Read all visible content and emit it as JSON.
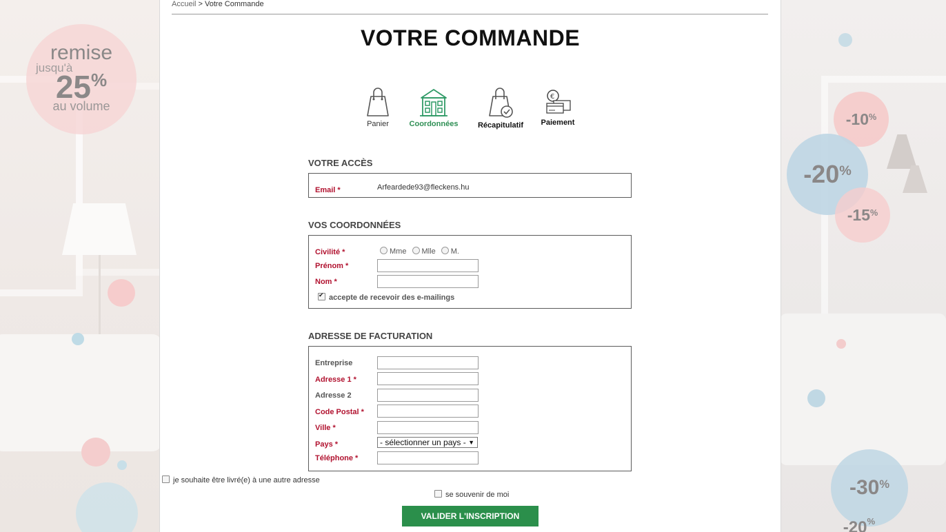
{
  "breadcrumb": {
    "home": "Accueil",
    "separator": ">",
    "current": "Votre Commande"
  },
  "title": "VOTRE COMMANDE",
  "steps": [
    {
      "label": "Panier",
      "icon": "bag-icon",
      "active": false
    },
    {
      "label": "Coordonnées",
      "icon": "house-icon",
      "active": true
    },
    {
      "label": "Récapitulatif",
      "icon": "bag-check-icon",
      "active": false
    },
    {
      "label": "Paiement",
      "icon": "payment-cards-icon",
      "active": false
    }
  ],
  "access": {
    "title": "VOTRE ACCÈS",
    "email_label": "Email *",
    "email_value": "Arfeardede93@fleckens.hu"
  },
  "coords": {
    "title": "VOS COORDONNÉES",
    "civilite_label": "Civilité *",
    "civilite_options": [
      "Mme",
      "Mlle",
      "M."
    ],
    "prenom_label": "Prénom *",
    "prenom_value": "",
    "nom_label": "Nom *",
    "nom_value": "",
    "mailing_label": "accepte de recevoir des e-mailings",
    "mailing_checked": true
  },
  "billing": {
    "title": "ADRESSE DE FACTURATION",
    "entreprise_label": "Entreprise",
    "adresse1_label": "Adresse 1 *",
    "adresse2_label": "Adresse 2",
    "code_postal_label": "Code Postal *",
    "ville_label": "Ville *",
    "pays_label": "Pays *",
    "pays_value": "- sélectionner un pays -",
    "telephone_label": "Téléphone *"
  },
  "other_address_label": "je souhaite être livré(e) à une autre adresse",
  "remember_label": "se souvenir de moi",
  "submit_label": "VALIDER L'INSCRIPTION",
  "promo_left": {
    "line1": "remise",
    "line2": "jusqu'à",
    "amount": "25",
    "percent": "%",
    "line4": "au volume"
  },
  "discounts": [
    {
      "value": "-10",
      "percent": "%"
    },
    {
      "value": "-20",
      "percent": "%"
    },
    {
      "value": "-15",
      "percent": "%"
    },
    {
      "value": "-30",
      "percent": "%"
    },
    {
      "value": "-20",
      "percent": "%"
    }
  ],
  "colors": {
    "accent_green": "#2b8f4b",
    "required_red": "#b1122f",
    "pink_bubble": "#f5c6c6",
    "blue_bubble": "#bcd6e3"
  }
}
